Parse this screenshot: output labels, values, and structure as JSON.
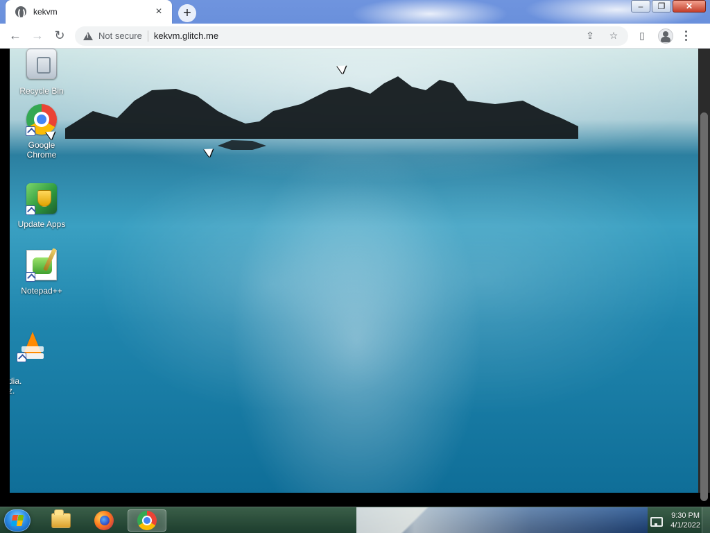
{
  "browser": {
    "tab": {
      "title": "kekvm"
    },
    "toolbar": {
      "security_text": "Not secure",
      "url": "kekvm.glitch.me"
    }
  },
  "remote_desktop": {
    "desktop_icons": [
      {
        "name": "recycle-bin",
        "label": "Recycle Bin"
      },
      {
        "name": "google-chrome",
        "label": "Google Chrome"
      },
      {
        "name": "update-apps",
        "label": "Update Apps"
      },
      {
        "name": "notepad-plus-plus",
        "label": "Notepad++"
      },
      {
        "name": "vlc-media-player",
        "label": "dia.\nz."
      }
    ]
  },
  "taskbar": {
    "pinned": [
      {
        "name": "file-explorer"
      },
      {
        "name": "firefox"
      },
      {
        "name": "chrome",
        "active": true
      }
    ],
    "clock": {
      "time": "9:30 PM",
      "date": "4/1/2022"
    }
  },
  "colors": {
    "chrome_toolbar_bg": "#ffffff",
    "omnibox_bg": "#f1f3f4",
    "taskbar_start": "#2e8fe6"
  }
}
